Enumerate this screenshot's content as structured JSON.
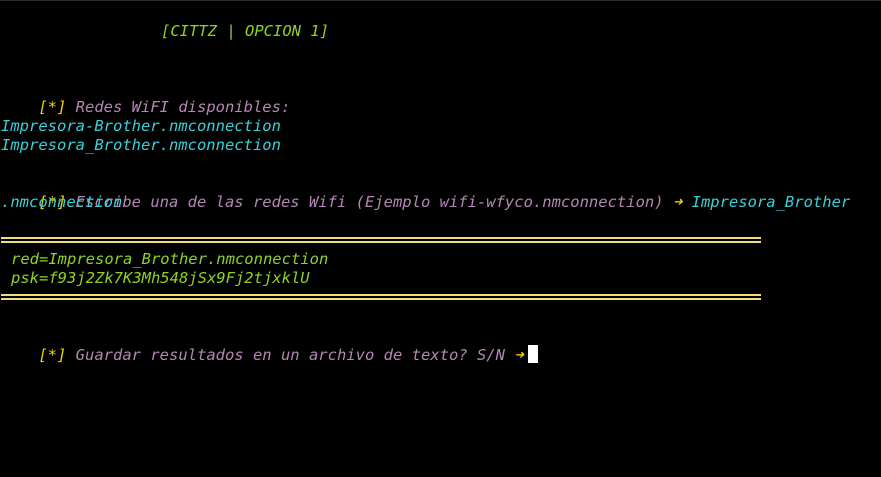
{
  "header": {
    "title": "[CITTZ | OPCION 1]"
  },
  "prompt_marker": "[*]",
  "arrow": "➜",
  "wifi_list": {
    "heading": "Redes WiFI disponibles:",
    "networks": [
      "Impresora-Brother.nmconnection",
      "Impresora_Brother.nmconnection"
    ]
  },
  "selection": {
    "question": "Escribe una de las redes Wifi (Ejemplo wifi-wfyco.nmconnection)",
    "answer_line1": "Impresora_Brother",
    "answer_line2": ".nmconnection"
  },
  "result": {
    "red": "red=Impresora_Brother.nmconnection",
    "psk": "psk=f93j2Zk7K3Mh548jSx9Fj2tjxklU"
  },
  "save_prompt": {
    "question": "Guardar resultados en un archivo de texto? S/N"
  },
  "colors": {
    "background": "#000000",
    "title": "#8fd321",
    "network": "#39d0d6",
    "prompt_text": "#b487b4",
    "marker": "#f0d000",
    "rule": "#f0dd7a",
    "result": "#8fd321"
  }
}
